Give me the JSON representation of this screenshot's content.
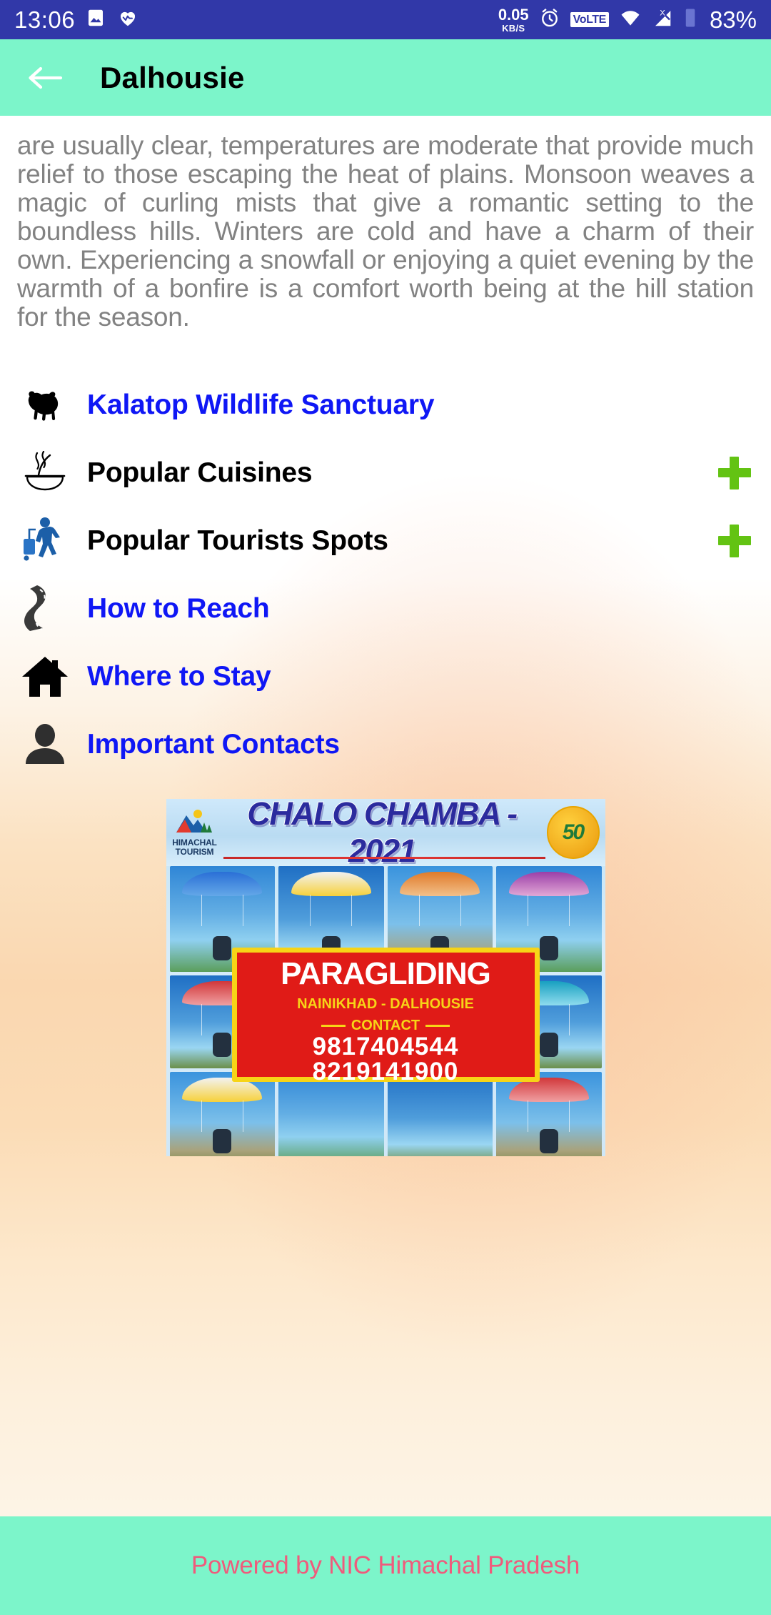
{
  "status_bar": {
    "time": "13:06",
    "data_rate_value": "0.05",
    "data_rate_unit": "KB/S",
    "volte_label": "VoLTE",
    "battery_percent": "83%",
    "icons": [
      "image-icon",
      "heart-icon",
      "alarm-clock-icon",
      "volte-icon",
      "wifi-icon",
      "signal-icon",
      "sim-icon"
    ],
    "background_color": "#3138a8"
  },
  "app_bar": {
    "back_label": "back-arrow",
    "title": "Dalhousie",
    "background_color": "#7cf5ca"
  },
  "content": {
    "paragraph": "are usually clear, temperatures are moderate that provide much relief to those escaping the heat of plains. Monsoon weaves a magic of curling mists that give a romantic setting to the boundless hills. Winters are cold and have a charm of their own. Experiencing a snowfall or enjoying a quiet evening by the warmth of a bonfire is a comfort worth being at the hill station for the season.",
    "link_color": "#0f17f5",
    "plus_color": "#63c313",
    "menu": [
      {
        "label": "Kalatop Wildlife Sanctuary",
        "icon": "bear-icon",
        "style": "link",
        "expandable": false
      },
      {
        "label": "Popular Cuisines",
        "icon": "soup-bowl-icon",
        "style": "plain",
        "expandable": true,
        "expand_label": "+"
      },
      {
        "label": "Popular Tourists Spots",
        "icon": "traveler-icon",
        "style": "plain",
        "expandable": true,
        "expand_label": "+"
      },
      {
        "label": "How to Reach",
        "icon": "road-icon",
        "style": "link",
        "expandable": false
      },
      {
        "label": "Where to Stay",
        "icon": "home-icon",
        "style": "link",
        "expandable": false
      },
      {
        "label": "Important Contacts",
        "icon": "person-icon",
        "style": "link",
        "expandable": false
      }
    ]
  },
  "poster": {
    "brand": "HIMACHAL",
    "brand2": "TOURISM",
    "headline": "CHALO CHAMBA - 2021",
    "seal": "50",
    "title": "PARAGLIDING",
    "location": "NAINIKHAD - DALHOUSIE",
    "contact_label": "CONTACT",
    "phone1": "9817404544",
    "phone2": "8219141900",
    "red": "#e01b17",
    "yellow": "#f7d417"
  },
  "footer": {
    "text": "Powered by NIC Himachal Pradesh",
    "text_color": "#ef5b7c",
    "background_color": "#7cf5ca"
  }
}
